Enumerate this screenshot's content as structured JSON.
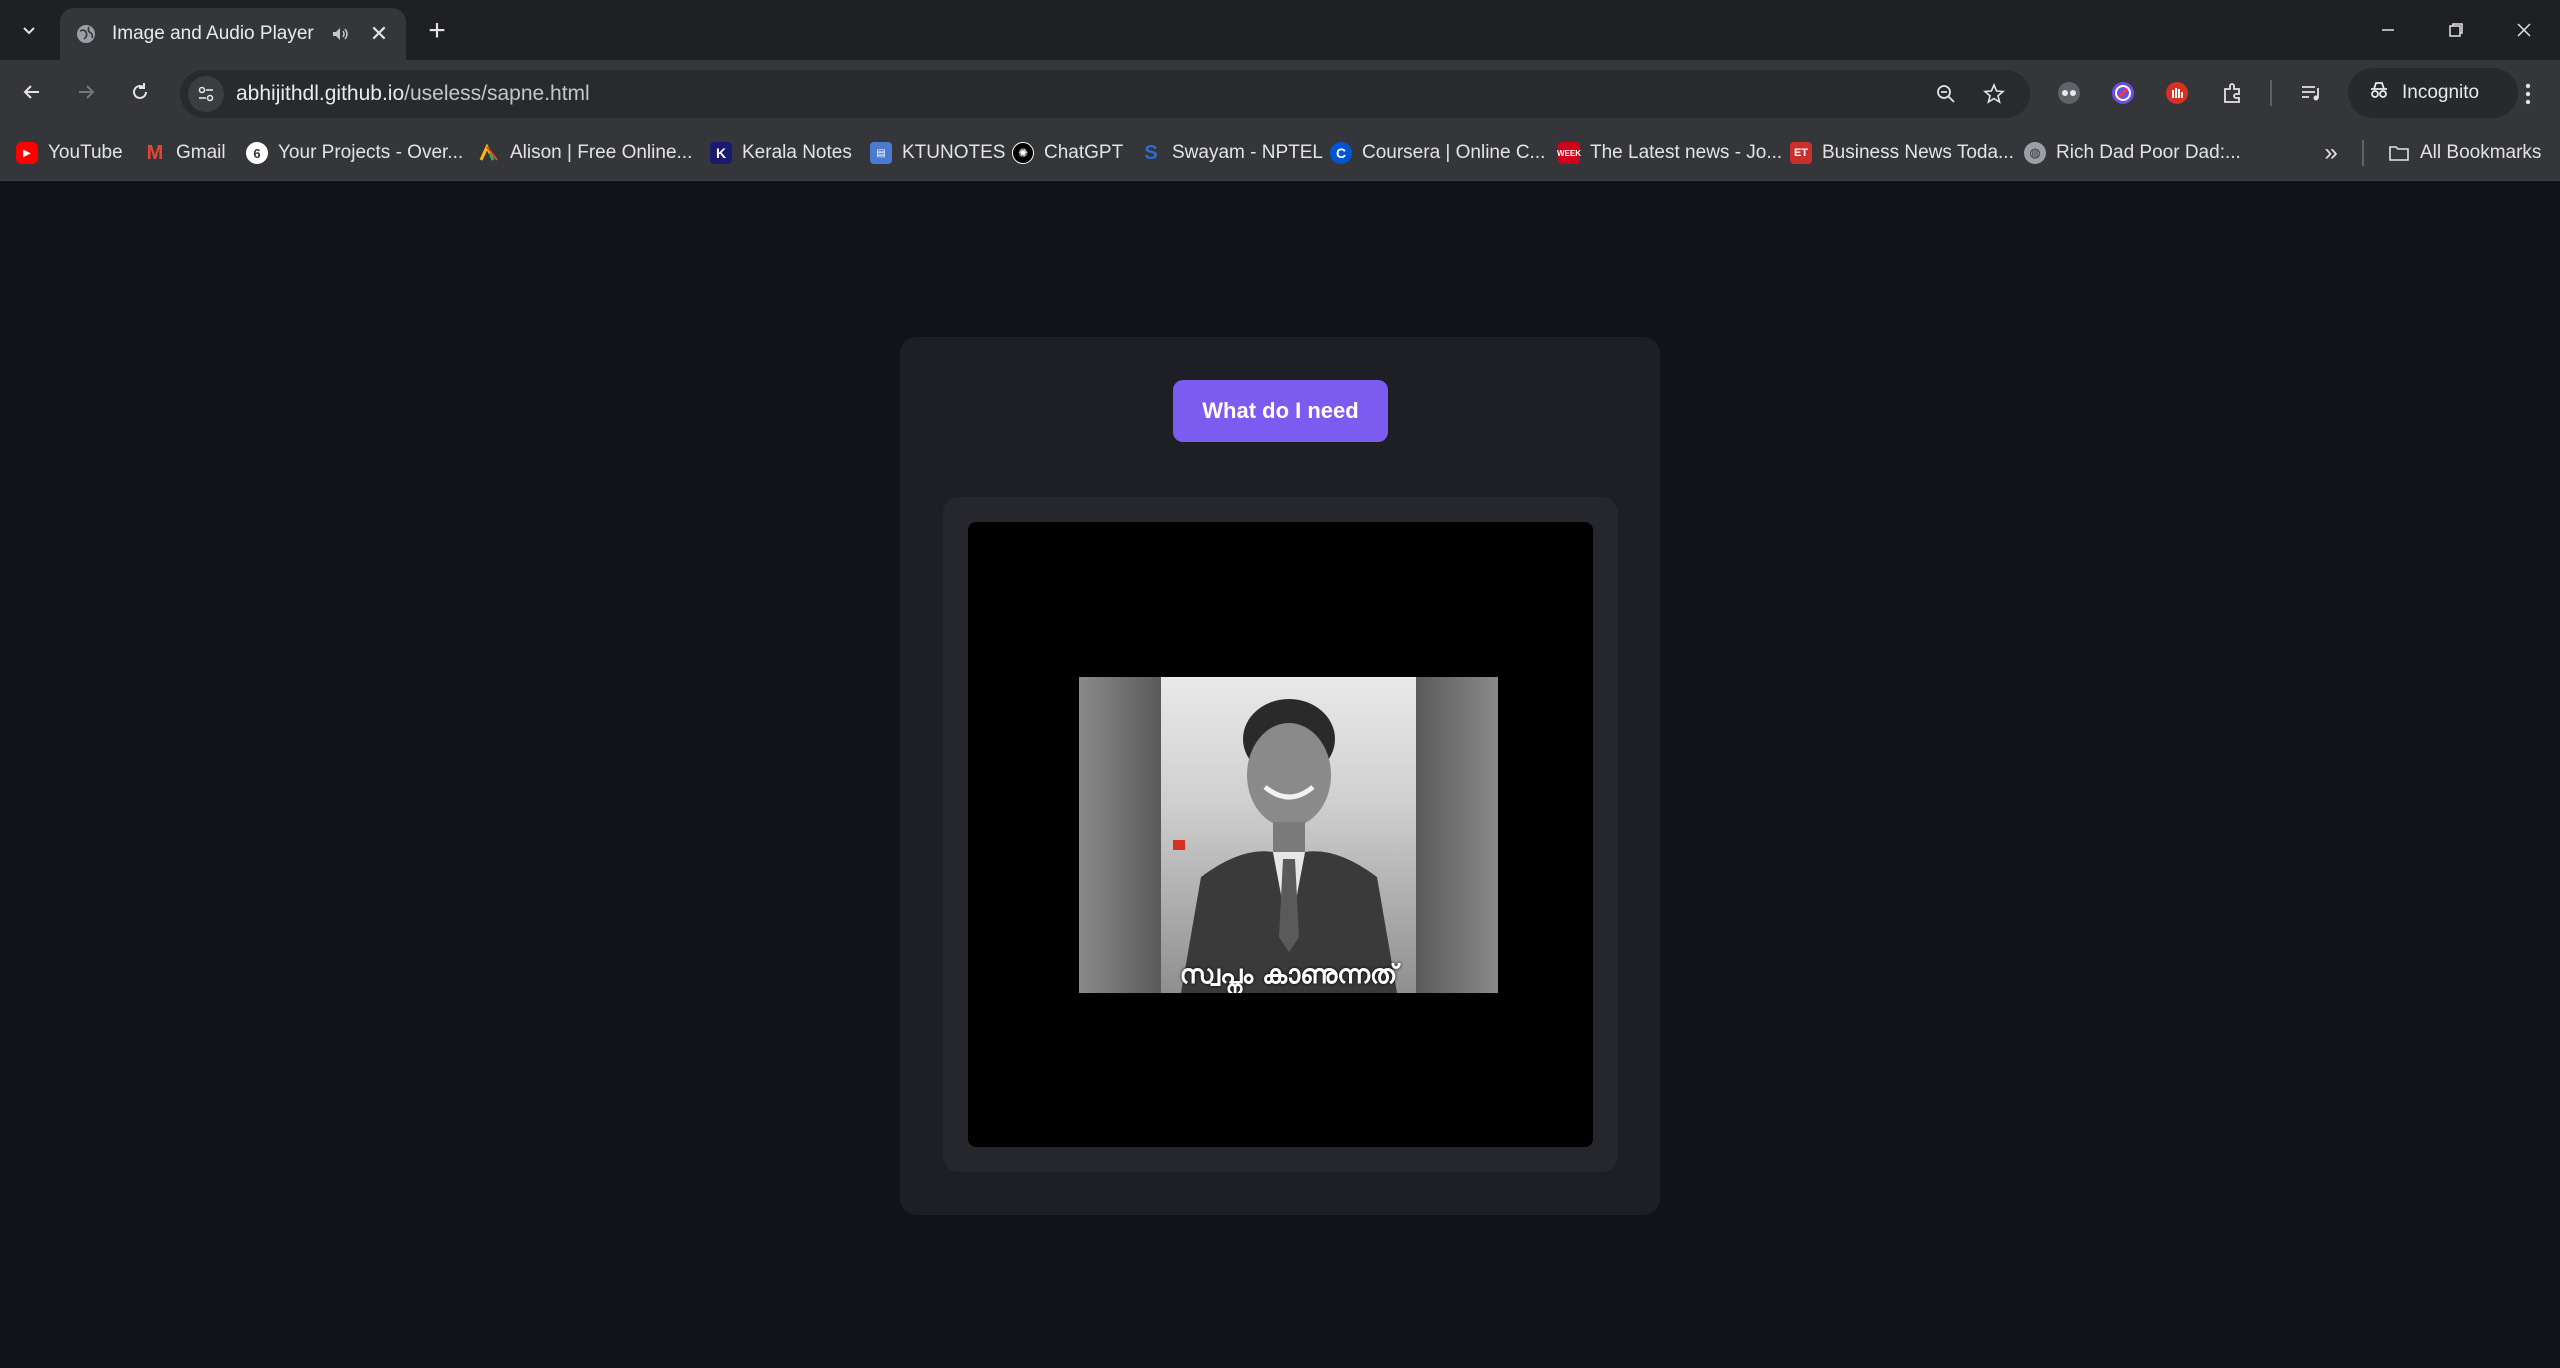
{
  "browser": {
    "tab": {
      "title": "Image and Audio Player"
    },
    "url": {
      "host": "abhijithdl.github.io",
      "path": "/useless/sapne.html"
    },
    "incognito_label": "Incognito",
    "bookmarks": [
      {
        "label": "YouTube",
        "icon": "youtube-icon",
        "color": "#ff0000"
      },
      {
        "label": "Gmail",
        "icon": "gmail-icon",
        "color": "#ea4335"
      },
      {
        "label": "Your Projects - Over...",
        "icon": "projects-icon",
        "color": "#ffffff"
      },
      {
        "label": "Alison | Free Online...",
        "icon": "alison-icon",
        "color": "#34a853"
      },
      {
        "label": "Kerala Notes",
        "icon": "kerala-notes-icon",
        "color": "#1a1a6e"
      },
      {
        "label": "KTUNOTES",
        "icon": "ktunotes-icon",
        "color": "#4a7bd0"
      },
      {
        "label": "ChatGPT",
        "icon": "chatgpt-icon",
        "color": "#000000"
      },
      {
        "label": "Swayam - NPTEL",
        "icon": "swayam-icon",
        "color": "#2b6cd0"
      },
      {
        "label": "Coursera | Online C...",
        "icon": "coursera-icon",
        "color": "#0056d2"
      },
      {
        "label": "The Latest news - Jo...",
        "icon": "week-icon",
        "color": "#d0021b"
      },
      {
        "label": "Business News Toda...",
        "icon": "et-icon",
        "color": "#c9302c"
      },
      {
        "label": "Rich Dad Poor Dad:...",
        "icon": "globe-icon",
        "color": "#9aa0a6"
      }
    ],
    "all_bookmarks_label": "All Bookmarks"
  },
  "page": {
    "button_label": "What do I need",
    "video_caption": "സ്വപ്നം കാണുന്നത്",
    "accent": "#7c5cf0"
  }
}
